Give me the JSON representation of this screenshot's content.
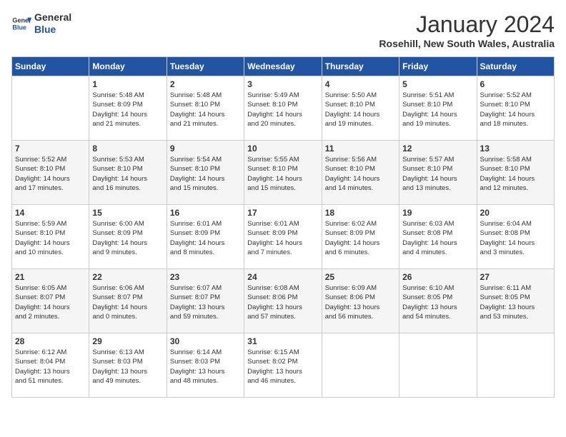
{
  "header": {
    "logo_line1": "General",
    "logo_line2": "Blue",
    "month": "January 2024",
    "location": "Rosehill, New South Wales, Australia"
  },
  "weekdays": [
    "Sunday",
    "Monday",
    "Tuesday",
    "Wednesday",
    "Thursday",
    "Friday",
    "Saturday"
  ],
  "weeks": [
    [
      {
        "day": "",
        "info": ""
      },
      {
        "day": "1",
        "info": "Sunrise: 5:48 AM\nSunset: 8:09 PM\nDaylight: 14 hours\nand 21 minutes."
      },
      {
        "day": "2",
        "info": "Sunrise: 5:48 AM\nSunset: 8:10 PM\nDaylight: 14 hours\nand 21 minutes."
      },
      {
        "day": "3",
        "info": "Sunrise: 5:49 AM\nSunset: 8:10 PM\nDaylight: 14 hours\nand 20 minutes."
      },
      {
        "day": "4",
        "info": "Sunrise: 5:50 AM\nSunset: 8:10 PM\nDaylight: 14 hours\nand 19 minutes."
      },
      {
        "day": "5",
        "info": "Sunrise: 5:51 AM\nSunset: 8:10 PM\nDaylight: 14 hours\nand 19 minutes."
      },
      {
        "day": "6",
        "info": "Sunrise: 5:52 AM\nSunset: 8:10 PM\nDaylight: 14 hours\nand 18 minutes."
      }
    ],
    [
      {
        "day": "7",
        "info": "Sunrise: 5:52 AM\nSunset: 8:10 PM\nDaylight: 14 hours\nand 17 minutes."
      },
      {
        "day": "8",
        "info": "Sunrise: 5:53 AM\nSunset: 8:10 PM\nDaylight: 14 hours\nand 16 minutes."
      },
      {
        "day": "9",
        "info": "Sunrise: 5:54 AM\nSunset: 8:10 PM\nDaylight: 14 hours\nand 15 minutes."
      },
      {
        "day": "10",
        "info": "Sunrise: 5:55 AM\nSunset: 8:10 PM\nDaylight: 14 hours\nand 15 minutes."
      },
      {
        "day": "11",
        "info": "Sunrise: 5:56 AM\nSunset: 8:10 PM\nDaylight: 14 hours\nand 14 minutes."
      },
      {
        "day": "12",
        "info": "Sunrise: 5:57 AM\nSunset: 8:10 PM\nDaylight: 14 hours\nand 13 minutes."
      },
      {
        "day": "13",
        "info": "Sunrise: 5:58 AM\nSunset: 8:10 PM\nDaylight: 14 hours\nand 12 minutes."
      }
    ],
    [
      {
        "day": "14",
        "info": "Sunrise: 5:59 AM\nSunset: 8:10 PM\nDaylight: 14 hours\nand 10 minutes."
      },
      {
        "day": "15",
        "info": "Sunrise: 6:00 AM\nSunset: 8:09 PM\nDaylight: 14 hours\nand 9 minutes."
      },
      {
        "day": "16",
        "info": "Sunrise: 6:01 AM\nSunset: 8:09 PM\nDaylight: 14 hours\nand 8 minutes."
      },
      {
        "day": "17",
        "info": "Sunrise: 6:01 AM\nSunset: 8:09 PM\nDaylight: 14 hours\nand 7 minutes."
      },
      {
        "day": "18",
        "info": "Sunrise: 6:02 AM\nSunset: 8:09 PM\nDaylight: 14 hours\nand 6 minutes."
      },
      {
        "day": "19",
        "info": "Sunrise: 6:03 AM\nSunset: 8:08 PM\nDaylight: 14 hours\nand 4 minutes."
      },
      {
        "day": "20",
        "info": "Sunrise: 6:04 AM\nSunset: 8:08 PM\nDaylight: 14 hours\nand 3 minutes."
      }
    ],
    [
      {
        "day": "21",
        "info": "Sunrise: 6:05 AM\nSunset: 8:07 PM\nDaylight: 14 hours\nand 2 minutes."
      },
      {
        "day": "22",
        "info": "Sunrise: 6:06 AM\nSunset: 8:07 PM\nDaylight: 14 hours\nand 0 minutes."
      },
      {
        "day": "23",
        "info": "Sunrise: 6:07 AM\nSunset: 8:07 PM\nDaylight: 13 hours\nand 59 minutes."
      },
      {
        "day": "24",
        "info": "Sunrise: 6:08 AM\nSunset: 8:06 PM\nDaylight: 13 hours\nand 57 minutes."
      },
      {
        "day": "25",
        "info": "Sunrise: 6:09 AM\nSunset: 8:06 PM\nDaylight: 13 hours\nand 56 minutes."
      },
      {
        "day": "26",
        "info": "Sunrise: 6:10 AM\nSunset: 8:05 PM\nDaylight: 13 hours\nand 54 minutes."
      },
      {
        "day": "27",
        "info": "Sunrise: 6:11 AM\nSunset: 8:05 PM\nDaylight: 13 hours\nand 53 minutes."
      }
    ],
    [
      {
        "day": "28",
        "info": "Sunrise: 6:12 AM\nSunset: 8:04 PM\nDaylight: 13 hours\nand 51 minutes."
      },
      {
        "day": "29",
        "info": "Sunrise: 6:13 AM\nSunset: 8:03 PM\nDaylight: 13 hours\nand 49 minutes."
      },
      {
        "day": "30",
        "info": "Sunrise: 6:14 AM\nSunset: 8:03 PM\nDaylight: 13 hours\nand 48 minutes."
      },
      {
        "day": "31",
        "info": "Sunrise: 6:15 AM\nSunset: 8:02 PM\nDaylight: 13 hours\nand 46 minutes."
      },
      {
        "day": "",
        "info": ""
      },
      {
        "day": "",
        "info": ""
      },
      {
        "day": "",
        "info": ""
      }
    ]
  ]
}
